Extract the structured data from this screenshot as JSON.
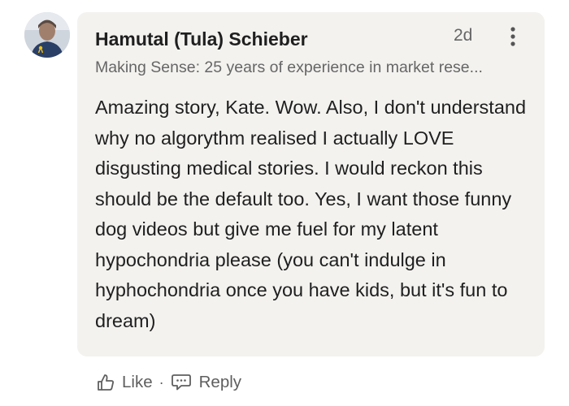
{
  "comment": {
    "author_name": "Hamutal (Tula) Schieber",
    "time_ago": "2d",
    "author_headline": "Making Sense: 25 years of experience in market rese...",
    "body": "Amazing story, Kate. Wow. Also, I don't understand why no algorythm realised I actually LOVE disgusting medical stories. I would reckon this should be the default too. Yes, I want those funny dog videos but give me fuel for my latent hypochondria please (you can't indulge in hyphochondria once you have kids, but it's fun to dream)",
    "avatar_icon": "profile-photo",
    "more_icon": "vertical-ellipsis-icon"
  },
  "actions": {
    "like_label": "Like",
    "separator": "·",
    "reply_label": "Reply",
    "like_icon": "thumbs-up-icon",
    "reply_icon": "speech-bubble-icon"
  },
  "colors": {
    "bubble_bg": "#f3f2ef",
    "text_primary": "#1f1f1f",
    "text_secondary": "#666666"
  }
}
